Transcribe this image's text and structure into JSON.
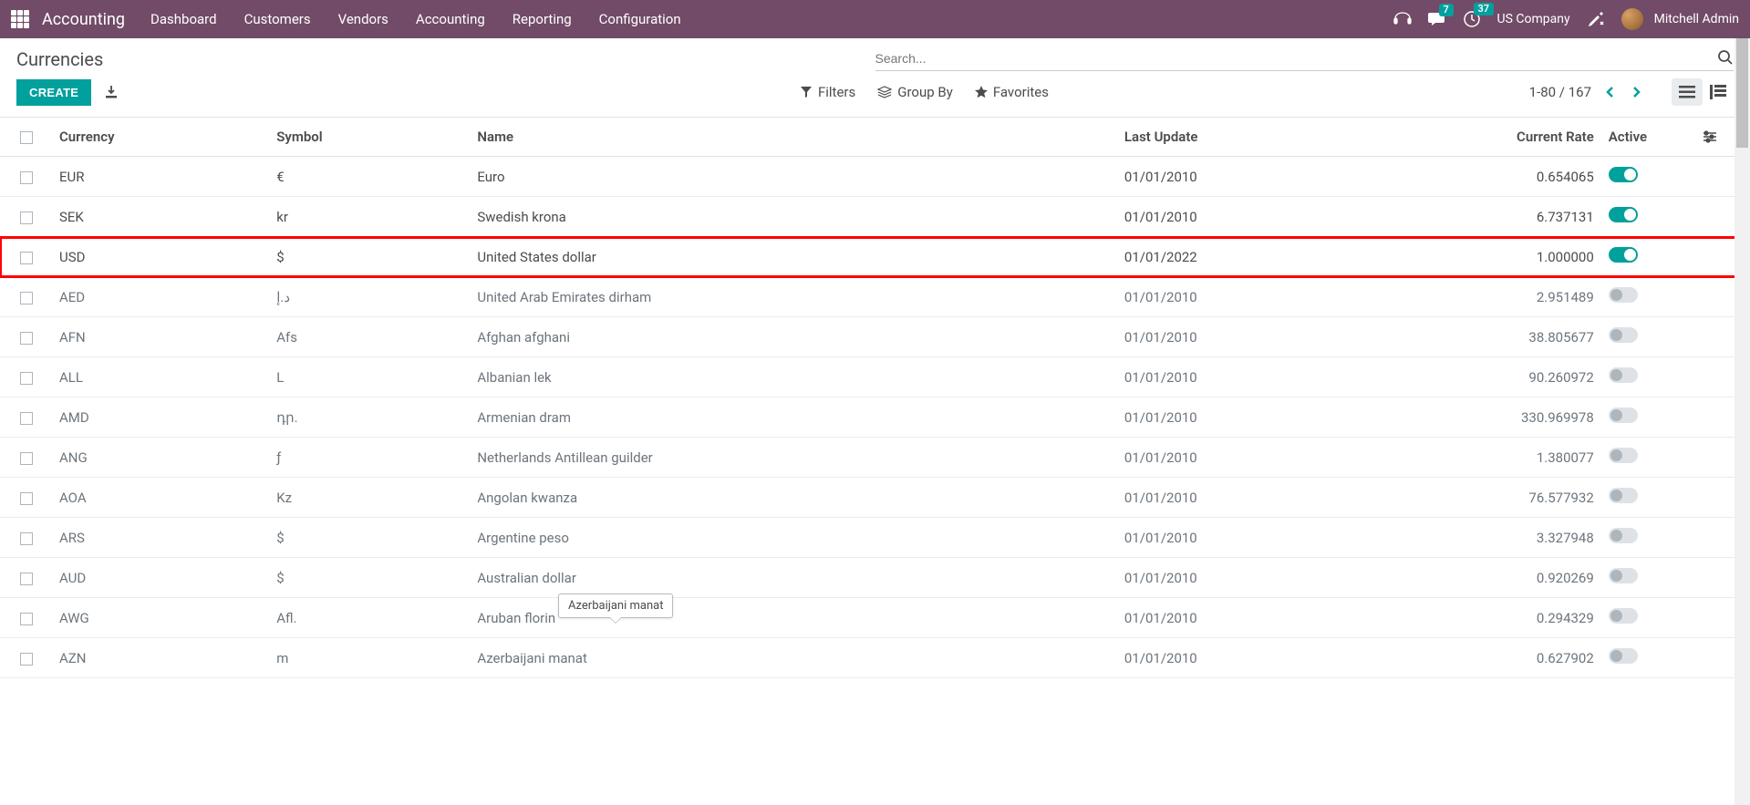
{
  "brand": "Accounting",
  "menu": [
    "Dashboard",
    "Customers",
    "Vendors",
    "Accounting",
    "Reporting",
    "Configuration"
  ],
  "badges": {
    "messages": "7",
    "activities": "37"
  },
  "company": "US Company",
  "user": "Mitchell Admin",
  "page_title": "Currencies",
  "search_placeholder": "Search...",
  "create_label": "CREATE",
  "filters_label": "Filters",
  "groupby_label": "Group By",
  "favorites_label": "Favorites",
  "pager_text": "1-80 / 167",
  "columns": {
    "currency": "Currency",
    "symbol": "Symbol",
    "name": "Name",
    "last_update": "Last Update",
    "current_rate": "Current Rate",
    "active": "Active"
  },
  "tooltip_text": "Azerbaijani manat",
  "rows": [
    {
      "code": "EUR",
      "symbol": "€",
      "name": "Euro",
      "last_update": "01/01/2010",
      "rate": "0.654065",
      "active": true,
      "highlighted": false
    },
    {
      "code": "SEK",
      "symbol": "kr",
      "name": "Swedish krona",
      "last_update": "01/01/2010",
      "rate": "6.737131",
      "active": true,
      "highlighted": false
    },
    {
      "code": "USD",
      "symbol": "$",
      "name": "United States dollar",
      "last_update": "01/01/2022",
      "rate": "1.000000",
      "active": true,
      "highlighted": true
    },
    {
      "code": "AED",
      "symbol": "د.إ",
      "name": "United Arab Emirates dirham",
      "last_update": "01/01/2010",
      "rate": "2.951489",
      "active": false,
      "highlighted": false
    },
    {
      "code": "AFN",
      "symbol": "Afs",
      "name": "Afghan afghani",
      "last_update": "01/01/2010",
      "rate": "38.805677",
      "active": false,
      "highlighted": false
    },
    {
      "code": "ALL",
      "symbol": "L",
      "name": "Albanian lek",
      "last_update": "01/01/2010",
      "rate": "90.260972",
      "active": false,
      "highlighted": false
    },
    {
      "code": "AMD",
      "symbol": "դր.",
      "name": "Armenian dram",
      "last_update": "01/01/2010",
      "rate": "330.969978",
      "active": false,
      "highlighted": false
    },
    {
      "code": "ANG",
      "symbol": "ƒ",
      "name": "Netherlands Antillean guilder",
      "last_update": "01/01/2010",
      "rate": "1.380077",
      "active": false,
      "highlighted": false
    },
    {
      "code": "AOA",
      "symbol": "Kz",
      "name": "Angolan kwanza",
      "last_update": "01/01/2010",
      "rate": "76.577932",
      "active": false,
      "highlighted": false
    },
    {
      "code": "ARS",
      "symbol": "$",
      "name": "Argentine peso",
      "last_update": "01/01/2010",
      "rate": "3.327948",
      "active": false,
      "highlighted": false
    },
    {
      "code": "AUD",
      "symbol": "$",
      "name": "Australian dollar",
      "last_update": "01/01/2010",
      "rate": "0.920269",
      "active": false,
      "highlighted": false
    },
    {
      "code": "AWG",
      "symbol": "Afl.",
      "name": "Aruban florin",
      "last_update": "01/01/2010",
      "rate": "0.294329",
      "active": false,
      "highlighted": false
    },
    {
      "code": "AZN",
      "symbol": "m",
      "name": "Azerbaijani manat",
      "last_update": "01/01/2010",
      "rate": "0.627902",
      "active": false,
      "highlighted": false
    }
  ]
}
